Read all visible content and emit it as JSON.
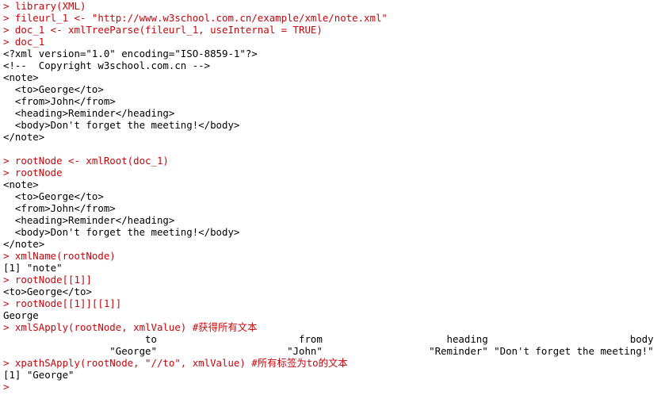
{
  "console": {
    "lines": [
      {
        "kind": "input",
        "text": "> library(XML)"
      },
      {
        "kind": "input",
        "text": "> fileurl_1 <- \"http://www.w3school.com.cn/example/xmle/note.xml\""
      },
      {
        "kind": "input",
        "text": "> doc_1 <- xmlTreeParse(fileurl_1, useInternal = TRUE)"
      },
      {
        "kind": "input",
        "text": "> doc_1"
      },
      {
        "kind": "output",
        "text": "<?xml version=\"1.0\" encoding=\"ISO-8859-1\"?>"
      },
      {
        "kind": "output",
        "text": "<!--  Copyright w3school.com.cn -->"
      },
      {
        "kind": "output",
        "text": "<note>"
      },
      {
        "kind": "output",
        "text": "  <to>George</to>"
      },
      {
        "kind": "output",
        "text": "  <from>John</from>"
      },
      {
        "kind": "output",
        "text": "  <heading>Reminder</heading>"
      },
      {
        "kind": "output",
        "text": "  <body>Don't forget the meeting!</body>"
      },
      {
        "kind": "output",
        "text": "</note>"
      },
      {
        "kind": "output",
        "text": ""
      },
      {
        "kind": "input",
        "text": "> rootNode <- xmlRoot(doc_1)"
      },
      {
        "kind": "input",
        "text": "> rootNode"
      },
      {
        "kind": "output",
        "text": "<note>"
      },
      {
        "kind": "output",
        "text": "  <to>George</to>"
      },
      {
        "kind": "output",
        "text": "  <from>John</from>"
      },
      {
        "kind": "output",
        "text": "  <heading>Reminder</heading>"
      },
      {
        "kind": "output",
        "text": "  <body>Don't forget the meeting!</body>"
      },
      {
        "kind": "output",
        "text": "</note>"
      },
      {
        "kind": "input",
        "text": "> xmlName(rootNode)"
      },
      {
        "kind": "output",
        "text": "[1] \"note\""
      },
      {
        "kind": "input",
        "text": "> rootNode[[1]]"
      },
      {
        "kind": "output",
        "text": "<to>George</to>"
      },
      {
        "kind": "input",
        "text": "> rootNode[[1]][[1]]"
      },
      {
        "kind": "output",
        "text": "George"
      },
      {
        "kind": "input",
        "text": "> xmlSApply(rootNode, xmlValue) #获得所有文本"
      },
      {
        "kind": "output",
        "text": "                        to                        from                     heading                        body"
      },
      {
        "kind": "output",
        "text": "                  \"George\"                      \"John\"                  \"Reminder\" \"Don't forget the meeting!\""
      },
      {
        "kind": "input",
        "text": "> xpathSApply(rootNode, \"//to\", xmlValue) #所有标签为to的文本"
      },
      {
        "kind": "output",
        "text": "[1] \"George\""
      },
      {
        "kind": "input",
        "text": "> "
      }
    ]
  }
}
